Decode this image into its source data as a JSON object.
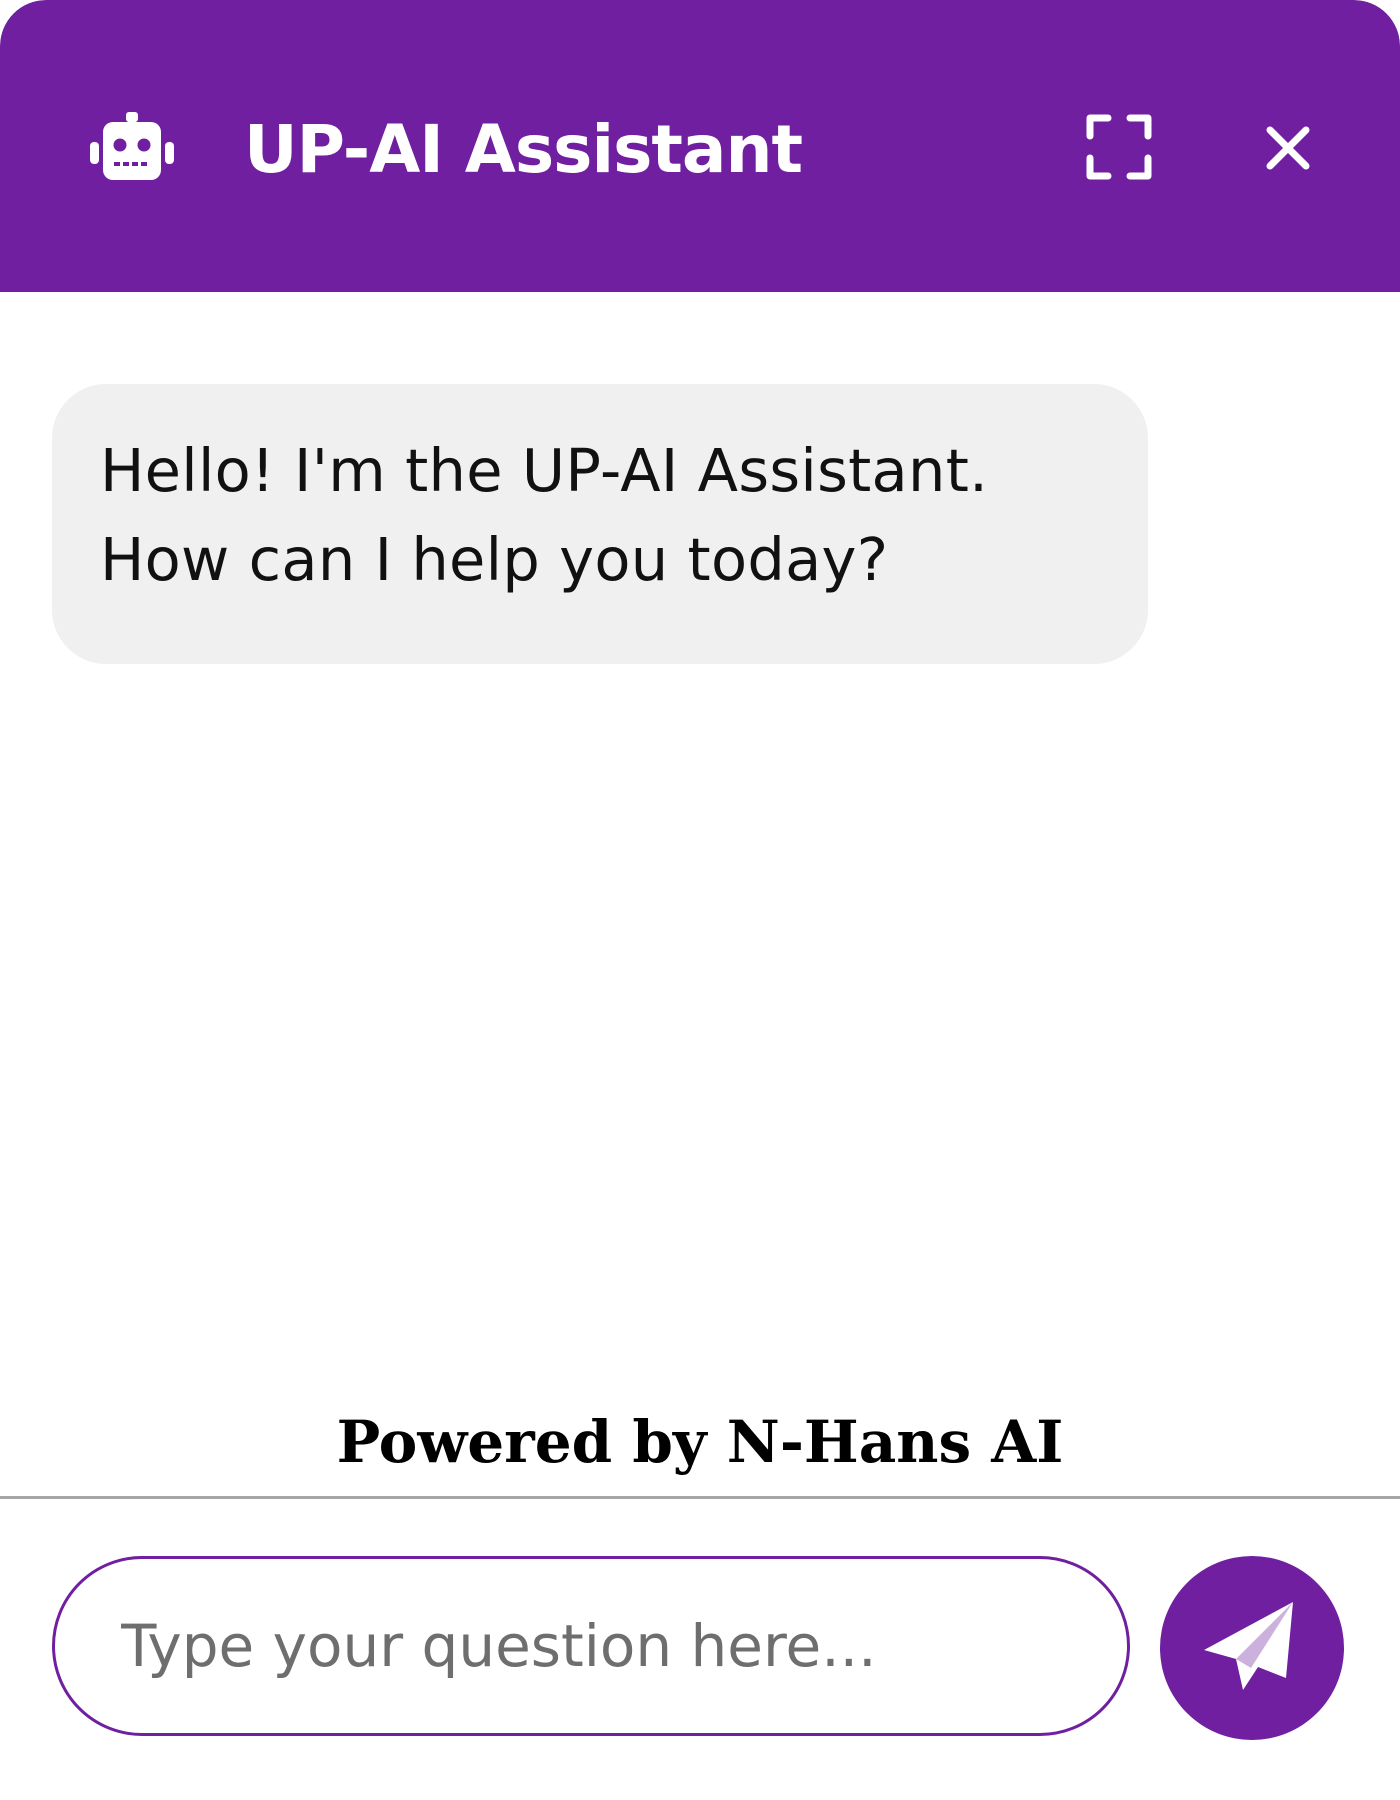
{
  "colors": {
    "brand": "#6f1f9f",
    "header_text": "#ffffff",
    "bubble_background": "#f0f0f0",
    "divider": "#a6a6a6",
    "placeholder": "#6e6e6e"
  },
  "header": {
    "icon": "robot-icon",
    "title": "UP-AI Assistant",
    "expand_icon": "expand-icon",
    "close_icon": "close-icon"
  },
  "messages": [
    {
      "sender": "assistant",
      "lines": [
        "Hello! I'm the UP-AI Assistant.",
        "How can I help you today?"
      ]
    }
  ],
  "footer": {
    "powered_by": "Powered by N-Hans AI"
  },
  "composer": {
    "value": "",
    "placeholder": "Type your question here...",
    "send_icon": "paper-plane-icon"
  }
}
